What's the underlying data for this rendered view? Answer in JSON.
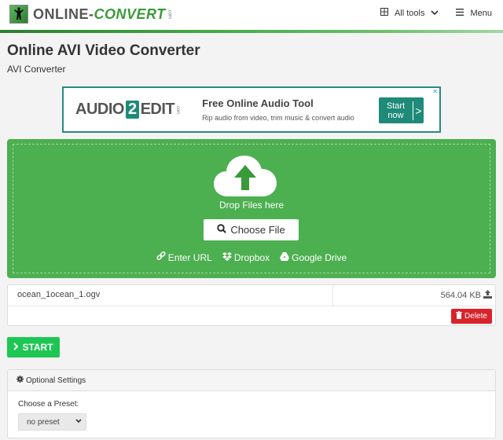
{
  "header": {
    "logo_prefix": "ONLINE-",
    "logo_suffix": "CONVERT",
    "logo_com": ".com",
    "nav": {
      "all_tools_label": "All tools",
      "menu_label": "Menu"
    }
  },
  "page": {
    "title": "Online AVI Video Converter",
    "subtitle": "AVI Converter"
  },
  "ad": {
    "logo_left": "AUDIO",
    "logo_number": "2",
    "logo_right": "EDIT",
    "logo_com": ".com",
    "title": "Free Online Audio Tool",
    "description": "Rip audio from video, trim music & convert audio",
    "button_line1": "Start",
    "button_line2": "now",
    "button_arrow": ">",
    "close": "✕"
  },
  "dropzone": {
    "drop_text": "Drop Files here",
    "choose_file_label": "Choose File",
    "sources": [
      {
        "label": "Enter URL",
        "icon": "link-icon"
      },
      {
        "label": "Dropbox",
        "icon": "dropbox-icon"
      },
      {
        "label": "Google Drive",
        "icon": "google-drive-icon"
      }
    ],
    "color": "#4caf50"
  },
  "file": {
    "name": "ocean_1ocean_1.ogv",
    "size": "564.04 KB",
    "delete_label": "Delete"
  },
  "start_label": "START",
  "settings": {
    "title": "Optional Settings",
    "preset_label": "Choose a Preset:",
    "preset_value": "no preset"
  }
}
